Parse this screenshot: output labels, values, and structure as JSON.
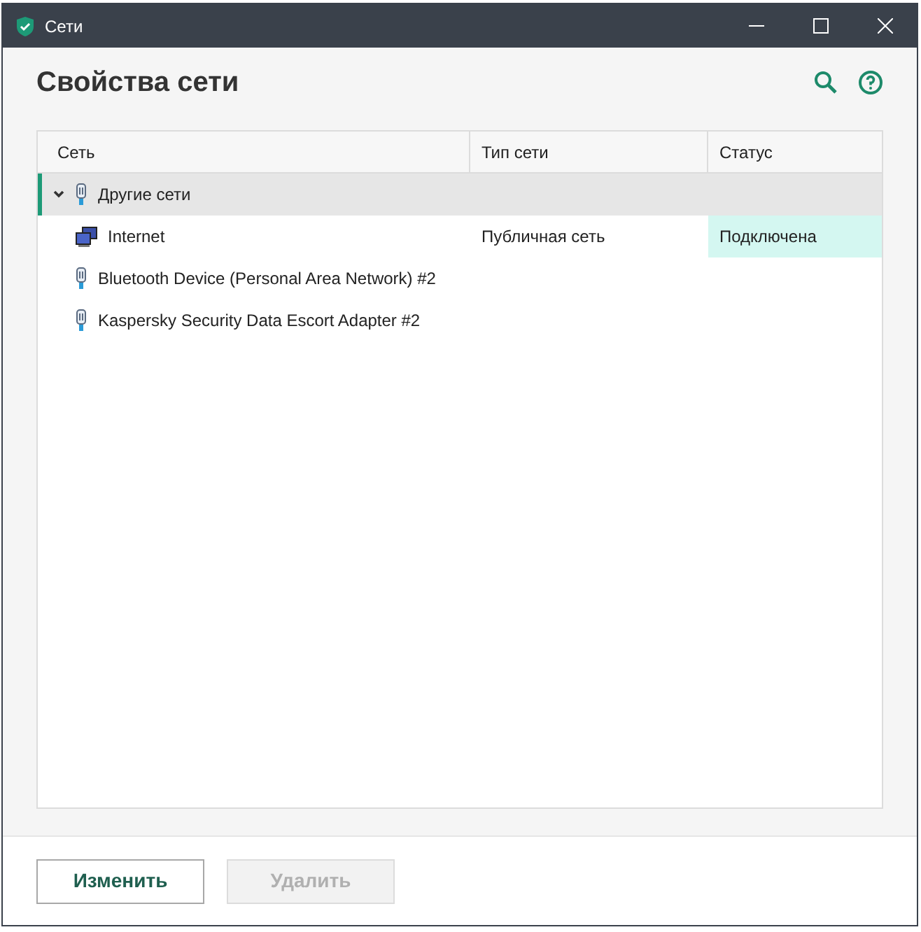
{
  "window": {
    "title": "Сети"
  },
  "header": {
    "title": "Свойства сети"
  },
  "table": {
    "columns": [
      "Сеть",
      "Тип сети",
      "Статус"
    ],
    "rows": [
      {
        "kind": "adapter",
        "name": "Другие сети",
        "expanded": true,
        "selected": true,
        "children": [
          {
            "kind": "computer",
            "name": "Internet",
            "type": "Публичная сеть",
            "status": "Подключена",
            "status_highlighted": true,
            "selected": false
          }
        ]
      },
      {
        "kind": "adapter",
        "name": "Bluetooth Device (Personal Area Network) #2",
        "selected": false
      },
      {
        "kind": "adapter",
        "name": "Kaspersky Security Data Escort Adapter #2",
        "selected": false
      }
    ]
  },
  "buttons": [
    {
      "label": "Изменить",
      "disabled": false
    },
    {
      "label": "Удалить",
      "disabled": true
    }
  ]
}
